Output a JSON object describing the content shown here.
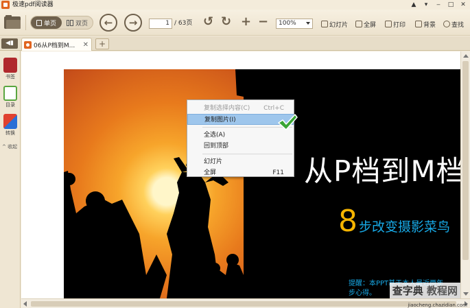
{
  "app": {
    "title": "极速pdf阅读器",
    "window_buttons": [
      "▲",
      "▾",
      "‒",
      "□",
      "✕"
    ]
  },
  "toolbar": {
    "single_page_label": "单页",
    "double_page_label": "双页",
    "current_page": "1",
    "total_pages": "/ 63页",
    "zoom": "100%",
    "slideshow_label": "幻灯片",
    "fullscreen_label": "全屏",
    "print_label": "打印",
    "background_label": "背景",
    "search_label": "查找"
  },
  "tabs": [
    {
      "label": "06从P档到M..."
    }
  ],
  "sidebar": {
    "bookmark_label": "书签",
    "toc_label": "目录",
    "convert_label": "转换",
    "collapse_label": "收起"
  },
  "slide": {
    "title": "从P档到M档",
    "number": "8",
    "subtitle": "步改变摄影菜鸟",
    "note_line1": "提醒：本PPT基于本人最近两年",
    "note_line2": "步心得。",
    "watermark": "查字典",
    "watermark_cn": "教程网",
    "watermark_url": "jiaocheng.chazidian.com"
  },
  "context_menu": {
    "items": [
      {
        "label": "复制选择内容(C)",
        "shortcut": "Ctrl+C",
        "disabled": true
      },
      {
        "label": "复制图片(I)",
        "shortcut": "",
        "hover": true
      },
      {
        "label": "全选(A)",
        "shortcut": ""
      },
      {
        "label": "回到顶部",
        "shortcut": ""
      },
      {
        "label": "幻灯片",
        "shortcut": ""
      },
      {
        "label": "全屏",
        "shortcut": "F11"
      }
    ]
  },
  "colors": {
    "accent_brown": "#6e604c",
    "slide_blue": "#17a9e6",
    "slide_number": "#f5b400",
    "check_green": "#3aa536"
  }
}
